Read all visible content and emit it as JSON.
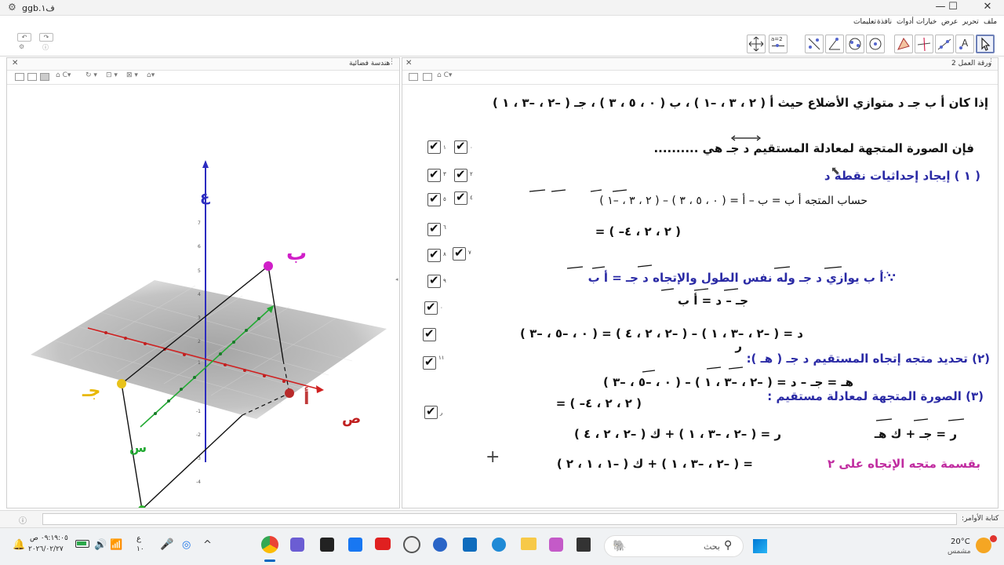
{
  "window": {
    "title": "ggb.ف١",
    "logo_icon": "geogebra-gear-icon",
    "minimize": "—",
    "maximize": "☐",
    "close": "✕"
  },
  "menu": [
    "ملف",
    "تحرير",
    "عرض",
    "خيارات",
    "أدوات",
    "نافذة",
    "تعليمات"
  ],
  "tools": [
    "move-tool",
    "point-tool",
    "line-tool",
    "perpendicular-tool",
    "polygon-tool",
    "circle-tool",
    "ellipse-tool",
    "angle-tool",
    "reflect-tool",
    "slider-tool",
    "move-view-tool"
  ],
  "tool_labels": {
    "text": "A",
    "slider": "a=2"
  },
  "undo": {
    "undo": "↶",
    "redo": "↷"
  },
  "left_panel": {
    "title": "هندسة فضائية",
    "axes": {
      "z": "ع",
      "y": "ص",
      "x": "س"
    },
    "points": {
      "a": "أ",
      "b": "ب",
      "c": "جـ",
      "d": "د"
    },
    "z_ticks": [
      "7",
      "6",
      "5",
      "4",
      "3",
      "2",
      "1",
      "-1",
      "-2",
      "-3",
      "-4"
    ]
  },
  "right_panel": {
    "title": "ورقة العمل 2",
    "lines": [
      "إذا كان أ ب جـ د متوازي الأضلاع حيث أ ( ٢ ، ٣ ، –١ ) ، ب ( ٠ ، ٥ ، ٣ ) ، جـ ( –٢ ، –٣ ، ١ )",
      "فإن الصورة المتجهة لمعادلة المستقيم د جـ هي ..........",
      "( ١ ) إيجاد إحداثيات نقطة د",
      "حساب المتجه أ ب = ب – أ = ( ٠ ، ٥ ، ٣ ) – ( ٢ ، ٣ ، –١ )",
      "= ( –٢ ، ٢ ، ٤ )",
      "∵ أ ب يوازي د جـ وله نفس الطول والإتجاه د جـ = أ ب",
      "جـ – د = أ ب",
      "د = ( –٢ ، –٣ ، ١ ) – ( –٢ ، ٢ ، ٤ ) = ( ٠ ، –٥ ، –٣ )",
      "ر",
      "(٢) تحديد متجه إتجاه المستقيم د جـ ( هـ ):",
      "هـ = جـ – د = ( –٢ ، –٣ ، ١ ) – ( ٠ ، –٥ ، –٣ )",
      "= ( –٢ ، ٢ ، ٤ )",
      "(٣) الصورة المتجهة لمعادلة مستقيم :",
      "ر = جـ + ك هـ",
      "ر = ( –٢ ، –٣ ، ١ ) + ك ( –٢ ، ٢ ، ٤ )",
      "بقسمة متجه الإتجاه على ٢",
      "= ( –٢ ، –٣ ، ١ ) + ك ( –١ ، ١ ، ٢ )"
    ],
    "checkboxes": [
      "٠",
      "١",
      "٢",
      "٣",
      "٤",
      "٥",
      "٦",
      "٧",
      "٨",
      "٩",
      "٠",
      "١١",
      "ر"
    ]
  },
  "command": {
    "label": "كتابة الأوامر:",
    "placeholder": ""
  },
  "taskbar": {
    "weather_temp": "20°C",
    "weather_desc": "مشمس",
    "search": "بحث",
    "time": "٠٩:١٩:٠٥ ص",
    "date": "٢٠٢٦/٠٢/٢٧",
    "lang": "ع",
    "lang2": "١٠"
  }
}
